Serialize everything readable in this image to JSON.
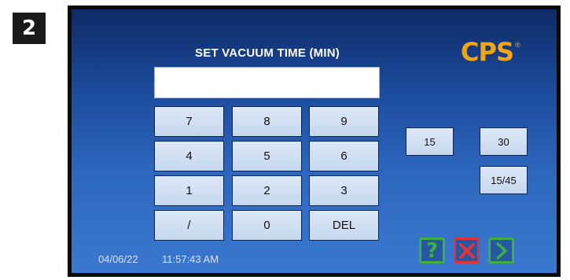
{
  "step_number": "2",
  "screen": {
    "title": "SET VACUUM TIME (MIN)",
    "entry_value": "",
    "keypad": {
      "k7": "7",
      "k8": "8",
      "k9": "9",
      "k4": "4",
      "k5": "5",
      "k6": "6",
      "k1": "1",
      "k2": "2",
      "k3": "3",
      "kslash": "/",
      "k0": "0",
      "kdel": "DEL"
    },
    "presets": {
      "p15": "15",
      "p30": "30",
      "p1545": "15/45"
    },
    "logo": {
      "text": "CPS",
      "reg_mark": "®"
    },
    "actions": {
      "help": "?",
      "help_icon": "question-icon",
      "cancel_icon": "close-icon",
      "next_icon": "chevron-right-icon"
    },
    "footer": {
      "date": "04/06/22",
      "time": "11:57:43 AM"
    }
  },
  "colors": {
    "logo": "#f0a416",
    "help_green": "#3cb043",
    "cancel_red": "#e0343a",
    "key_face": "#d2e0f2",
    "screen_top": "#0d2a66",
    "screen_bottom": "#3a79d0"
  }
}
